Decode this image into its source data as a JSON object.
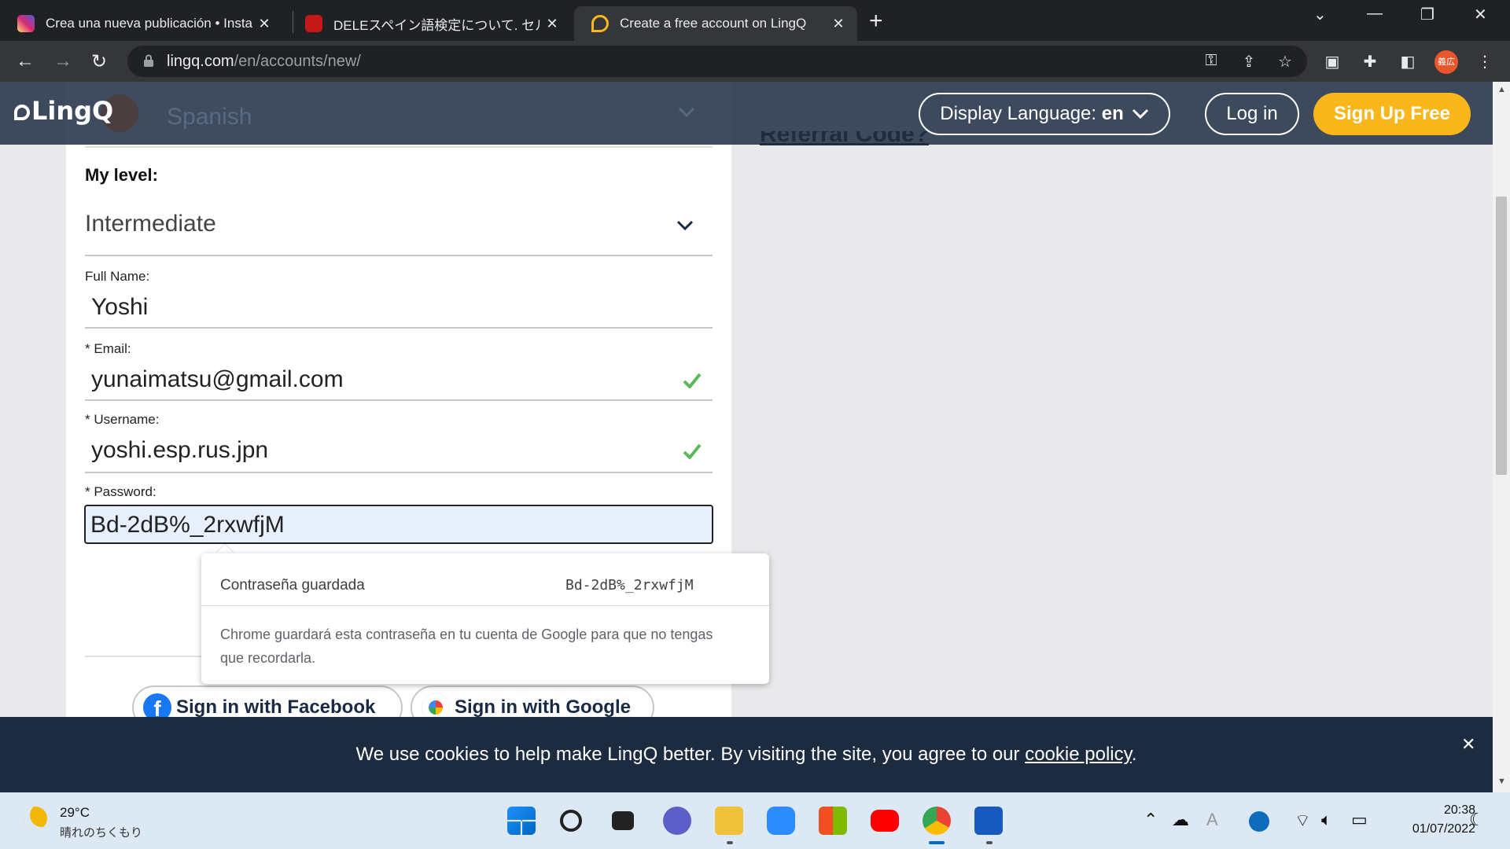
{
  "browser": {
    "tabs": [
      {
        "title": "Crea una nueva publicación • Insta",
        "favicon": "instagram-icon",
        "color": "#d6249f"
      },
      {
        "title": "DELEスペイン語検定について. セルバ",
        "favicon": "dele-icon",
        "color": "#c41818"
      },
      {
        "title": "Create a free account on LingQ",
        "favicon": "lingq-icon",
        "color": "#f9b71b",
        "active": true
      }
    ],
    "url_host": "lingq.com",
    "url_path": "/en/accounts/new/",
    "profile_label": "義広"
  },
  "site_header": {
    "logo": "LingQ",
    "language_ghost": "Spanish",
    "referral": "Referral Code?",
    "display_language_label": "Display Language:",
    "display_language_value": "en",
    "login": "Log in",
    "signup": "Sign Up Free"
  },
  "form": {
    "level_label": "My level:",
    "level_value": "Intermediate",
    "fullname_label": "Full Name:",
    "fullname_value": "Yoshi",
    "email_label": "* Email:",
    "email_value": "yunaimatsu@gmail.com",
    "username_label": "* Username:",
    "username_value": "yoshi.esp.rus.jpn",
    "password_label": "* Password:",
    "password_value": "Bd-2dB%_2rxwfjM"
  },
  "password_popup": {
    "title": "Contraseña guardada",
    "password": "Bd-2dB%_2rxwfjM",
    "info": "Chrome guardará esta contraseña en tu cuenta de Google para que no tengas que recordarla."
  },
  "social": {
    "facebook": "Sign in with Facebook",
    "google": "Sign in with Google"
  },
  "cookie_banner": {
    "message": "We use cookies to help make LingQ better. By visiting the site, you agree to our",
    "link": "cookie policy",
    "suffix": "."
  },
  "taskbar": {
    "temperature": "29°C",
    "weather_desc": "晴れのちくもり",
    "time": "20:38",
    "date": "01/07/2022"
  }
}
